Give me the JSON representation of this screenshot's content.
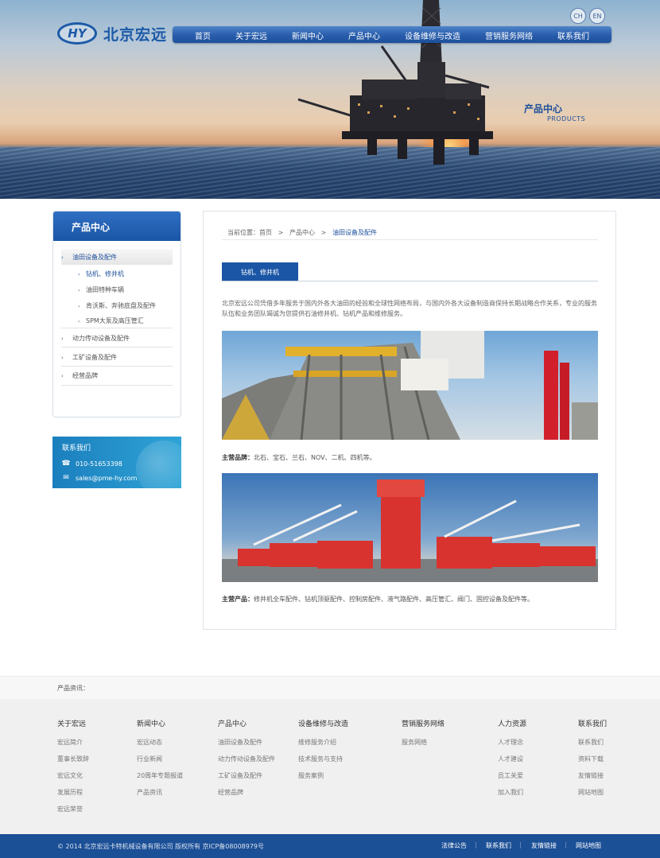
{
  "brand": {
    "mark": "HY",
    "name": "北京宏远"
  },
  "lang": {
    "ch": "CH",
    "en": "EN"
  },
  "nav": [
    "首页",
    "关于宏远",
    "新闻中心",
    "产品中心",
    "设备维修与改造",
    "营销服务网络",
    "联系我们"
  ],
  "banner": {
    "title": "产品中心",
    "subtitle": "PRODUCTS"
  },
  "sidebar": {
    "title": "产品中心",
    "items": [
      {
        "label": "油田设备及配件",
        "active": true
      },
      {
        "label": "动力传动设备及配件"
      },
      {
        "label": "工矿设备及配件"
      },
      {
        "label": "经营品牌"
      }
    ],
    "subitems": [
      "钻机、修井机",
      "油田特种车辆",
      "肯沃斯、奔驰底盘及配件",
      "SPM大泵及高压管汇"
    ]
  },
  "contact": {
    "title": "联系我们",
    "phone": "010-51653398",
    "email": "sales@pme-hy.com"
  },
  "breadcrumb": {
    "prefix": "当前位置：",
    "home": "首页",
    "sep": ">",
    "level1": "产品中心",
    "current": "油田设备及配件"
  },
  "tab": {
    "label": "钻机、修井机"
  },
  "intro": "北京宏远公司凭借多年服务于国内外各大油田的经验和全球性网络布局，与国内外各大设备制造商保持长期战略合作关系，专业的服务队伍和业务团队竭诚为您提供石油修井机、钻机产品和维修服务。",
  "captions": {
    "brands_label": "主营品牌：",
    "brands_text": "北石、宝石、兰石、NOV、二机、四机等。",
    "products_label": "主营产品：",
    "products_text": "修井机全车配件、钻机顶驱配件、控制房配件、液气路配件、高压管汇、阀门、固控设备及配件等。"
  },
  "news": {
    "label": "产品资讯："
  },
  "footer": {
    "columns": [
      {
        "title": "关于宏远",
        "links": [
          "宏远简介",
          "董事长致辞",
          "宏远文化",
          "发展历程",
          "宏远荣誉"
        ]
      },
      {
        "title": "新闻中心",
        "links": [
          "宏远动态",
          "行业新闻",
          "20周年专题报道",
          "产品资讯"
        ]
      },
      {
        "title": "产品中心",
        "links": [
          "油田设备及配件",
          "动力传动设备及配件",
          "工矿设备及配件",
          "经营品牌"
        ]
      },
      {
        "title": "设备维修与改造",
        "links": [
          "维修服务介绍",
          "技术服务与支持",
          "服务案例"
        ]
      },
      {
        "title": "营销服务网络",
        "links": [
          "服务网络"
        ]
      },
      {
        "title": "人力资源",
        "links": [
          "人才理念",
          "人才建设",
          "员工关爱",
          "加入我们"
        ]
      },
      {
        "title": "联系我们",
        "links": [
          "联系我们",
          "资料下载",
          "友情链接",
          "网站地图"
        ]
      }
    ],
    "copyright": "© 2014 北京宏远卡特机械设备有限公司 版权所有 京ICP备08008979号",
    "bottom_links": [
      "法律公告",
      "联系我们",
      "友情链接",
      "网站地图"
    ],
    "sep": "|"
  },
  "colors": {
    "primary": "#1b56a6",
    "footer_bar": "#1b4f96",
    "contact_bg": "#2fa4d6"
  }
}
